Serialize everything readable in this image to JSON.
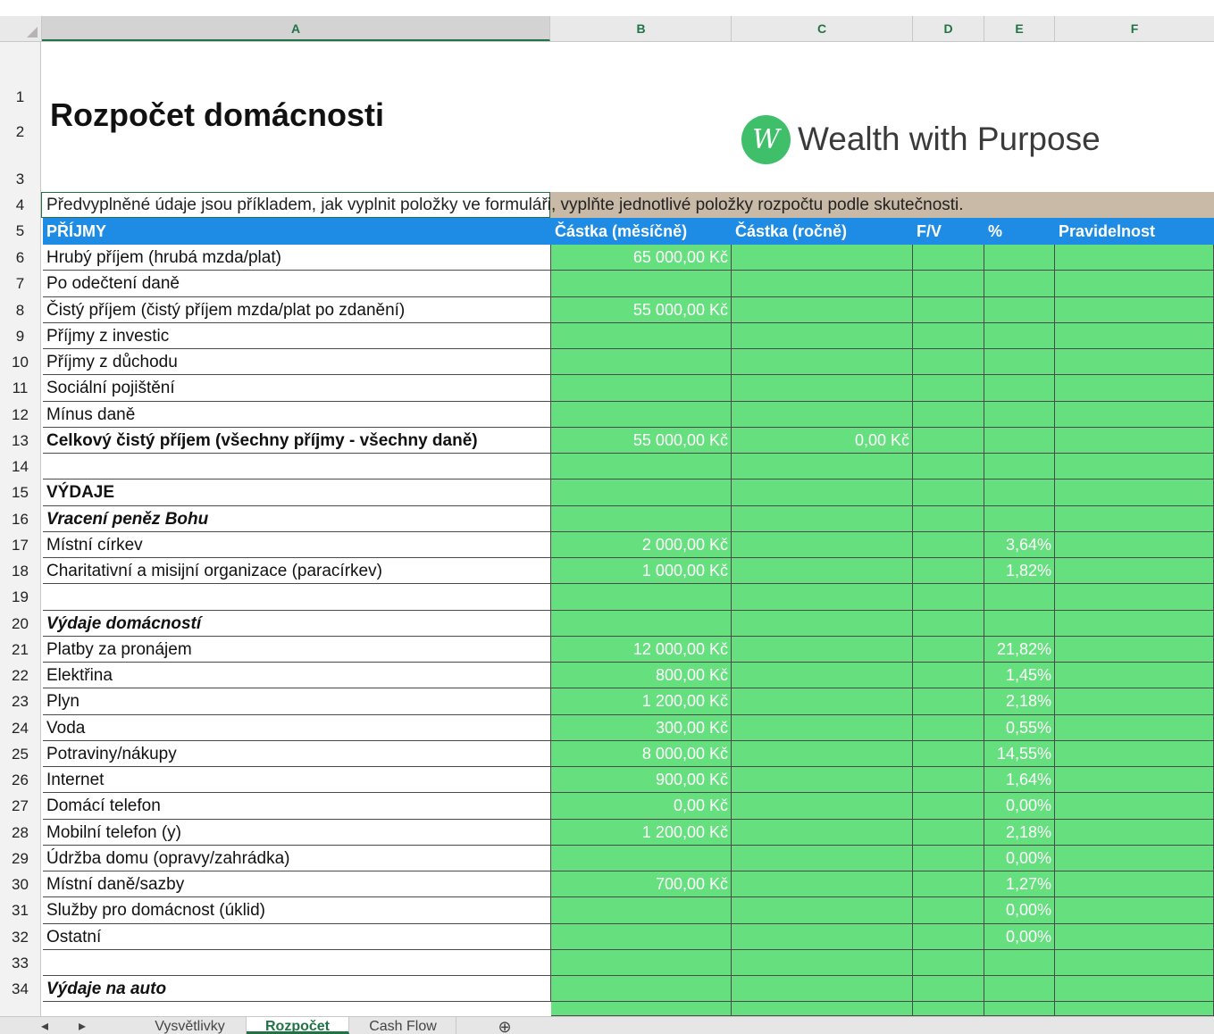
{
  "columns": [
    "A",
    "B",
    "C",
    "D",
    "E",
    "F"
  ],
  "title": "Rozpočet domácnosti",
  "logo": {
    "mark": "W",
    "name": "Wealth with Purpose"
  },
  "note": "Předvyplněné údaje jsou příkladem, jak vyplnit položky ve formuláři, vyplňte jednotlivé položky rozpočtu podle skutečnosti.",
  "header": {
    "label": "PŘÍJMY",
    "monthly": "Částka (měsíčně)",
    "yearly": "Částka (ročně)",
    "fv": "F/V",
    "pct": "%",
    "reg": "Pravidelnost"
  },
  "rows": [
    {
      "n": "6",
      "label": "Hrubý příjem (hrubá mzda/plat)",
      "b": "65 000,00 Kč",
      "c": "",
      "e": ""
    },
    {
      "n": "7",
      "label": "Po odečtení daně",
      "b": "",
      "c": "",
      "e": ""
    },
    {
      "n": "8",
      "label": "Čistý příjem (čistý příjem mzda/plat po zdanění)",
      "b": "55 000,00 Kč",
      "c": "",
      "e": ""
    },
    {
      "n": "9",
      "label": "Příjmy z investic",
      "b": "",
      "c": "",
      "e": ""
    },
    {
      "n": "10",
      "label": "Příjmy z důchodu",
      "b": "",
      "c": "",
      "e": ""
    },
    {
      "n": "11",
      "label": "Sociální pojištění",
      "b": "",
      "c": "",
      "e": ""
    },
    {
      "n": "12",
      "label": "Mínus daně",
      "b": "",
      "c": "",
      "e": ""
    },
    {
      "n": "13",
      "label": "Celkový čistý příjem (všechny příjmy - všechny daně)",
      "b": "55 000,00 Kč",
      "c": "0,00 Kč",
      "e": "",
      "bold": true
    },
    {
      "n": "14",
      "label": "",
      "b": "",
      "c": "",
      "e": ""
    },
    {
      "n": "15",
      "label": "VÝDAJE",
      "b": "",
      "c": "",
      "e": "",
      "bold": true
    },
    {
      "n": "16",
      "label": "Vracení peněz Bohu",
      "b": "",
      "c": "",
      "e": "",
      "bold": true,
      "italic": true
    },
    {
      "n": "17",
      "label": "Místní církev",
      "b": "2 000,00 Kč",
      "c": "",
      "e": "3,64%"
    },
    {
      "n": "18",
      "label": "Charitativní a misijní organizace (paracírkev)",
      "b": "1 000,00 Kč",
      "c": "",
      "e": "1,82%"
    },
    {
      "n": "19",
      "label": "",
      "b": "",
      "c": "",
      "e": ""
    },
    {
      "n": "20",
      "label": "Výdaje domácností",
      "b": "",
      "c": "",
      "e": "",
      "bold": true,
      "italic": true
    },
    {
      "n": "21",
      "label": "Platby za pronájem",
      "b": "12 000,00 Kč",
      "c": "",
      "e": "21,82%"
    },
    {
      "n": "22",
      "label": "Elektřina",
      "b": "800,00 Kč",
      "c": "",
      "e": "1,45%"
    },
    {
      "n": "23",
      "label": "Plyn",
      "b": "1 200,00 Kč",
      "c": "",
      "e": "2,18%"
    },
    {
      "n": "24",
      "label": "Voda",
      "b": "300,00 Kč",
      "c": "",
      "e": "0,55%"
    },
    {
      "n": "25",
      "label": "Potraviny/nákupy",
      "b": "8 000,00 Kč",
      "c": "",
      "e": "14,55%"
    },
    {
      "n": "26",
      "label": "Internet",
      "b": "900,00 Kč",
      "c": "",
      "e": "1,64%"
    },
    {
      "n": "27",
      "label": "Domácí telefon",
      "b": "0,00 Kč",
      "c": "",
      "e": "0,00%"
    },
    {
      "n": "28",
      "label": "Mobilní telefon (y)",
      "b": "1 200,00 Kč",
      "c": "",
      "e": "2,18%"
    },
    {
      "n": "29",
      "label": "Údržba domu (opravy/zahrádka)",
      "b": "",
      "c": "",
      "e": "0,00%"
    },
    {
      "n": "30",
      "label": "Místní daně/sazby",
      "b": "700,00 Kč",
      "c": "",
      "e": "1,27%"
    },
    {
      "n": "31",
      "label": "Služby pro domácnost (úklid)",
      "b": "",
      "c": "",
      "e": "0,00%"
    },
    {
      "n": "32",
      "label": "Ostatní",
      "b": "",
      "c": "",
      "e": "0,00%"
    },
    {
      "n": "33",
      "label": "",
      "b": "",
      "c": "",
      "e": ""
    },
    {
      "n": "34",
      "label": "Výdaje na auto",
      "b": "",
      "c": "",
      "e": "",
      "bold": true,
      "italic": true
    }
  ],
  "sheet_tabs": [
    "Vysvětlivky",
    "Rozpočet",
    "Cash Flow"
  ],
  "active_tab": "Rozpočet",
  "colors": {
    "header_blue": "#1e8be5",
    "cell_green": "#66e07f",
    "note_tan": "#c9b9a7",
    "excel_green": "#217346"
  }
}
